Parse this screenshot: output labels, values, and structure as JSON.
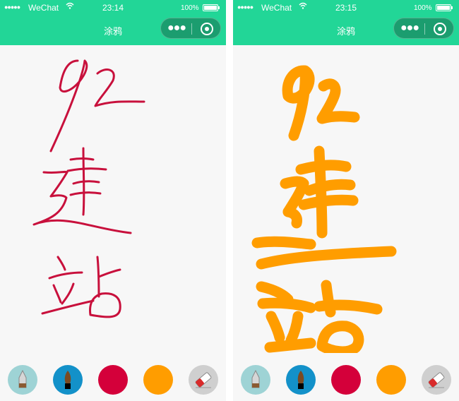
{
  "screens": [
    {
      "status": {
        "signal": "●●●●●",
        "carrier": "WeChat",
        "wifi": "wifi-icon",
        "time": "23:14",
        "battery": "100%"
      },
      "nav": {
        "title": "涂鸦",
        "menu": "more-dots-icon",
        "close": "target-circle-icon"
      },
      "canvas": {
        "stroke_color": "#c8103c",
        "stroke_width": "thin",
        "content": "92 建 站 handwritten strokes"
      },
      "toolbar": [
        {
          "name": "pen-tool",
          "color": "#9ed3d5"
        },
        {
          "name": "brush-tool",
          "color": "#1391c9"
        },
        {
          "name": "red-color",
          "color": "#d4003a"
        },
        {
          "name": "orange-color",
          "color": "#ff9d00"
        },
        {
          "name": "eraser-tool",
          "color": "#cfcfcf"
        }
      ]
    },
    {
      "status": {
        "signal": "●●●●●",
        "carrier": "WeChat",
        "wifi": "wifi-icon",
        "time": "23:15",
        "battery": "100%"
      },
      "nav": {
        "title": "涂鸦",
        "menu": "more-dots-icon",
        "close": "target-circle-icon"
      },
      "canvas": {
        "stroke_color": "#ff9d00",
        "stroke_width": "thick",
        "content": "92 建 站 handwritten strokes"
      },
      "toolbar": [
        {
          "name": "pen-tool",
          "color": "#9ed3d5"
        },
        {
          "name": "brush-tool",
          "color": "#1391c9"
        },
        {
          "name": "red-color",
          "color": "#d4003a"
        },
        {
          "name": "orange-color",
          "color": "#ff9d00"
        },
        {
          "name": "eraser-tool",
          "color": "#cfcfcf"
        }
      ]
    }
  ]
}
